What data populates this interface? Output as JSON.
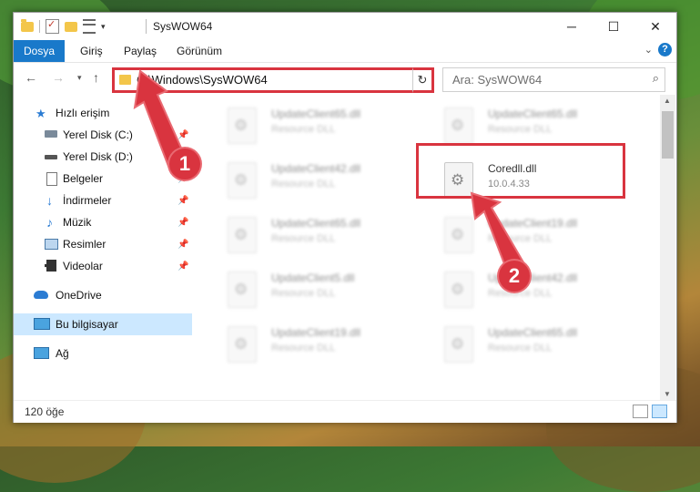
{
  "window": {
    "title": "SysWOW64"
  },
  "ribbon": {
    "tabs": [
      "Dosya",
      "Giriş",
      "Paylaş",
      "Görünüm"
    ]
  },
  "address": {
    "path": "C:\\Windows\\SysWOW64"
  },
  "search": {
    "placeholder": "Ara: SysWOW64"
  },
  "sidebar": {
    "items": [
      {
        "label": "Hızlı erişim",
        "icon": "star-icon"
      },
      {
        "label": "Yerel Disk (C:)",
        "icon": "drive-icon",
        "pinned": true
      },
      {
        "label": "Yerel Disk (D:)",
        "icon": "drive-icon"
      },
      {
        "label": "Belgeler",
        "icon": "documents-icon",
        "pinned": true
      },
      {
        "label": "İndirmeler",
        "icon": "download-icon",
        "pinned": true
      },
      {
        "label": "Müzik",
        "icon": "music-icon",
        "pinned": true
      },
      {
        "label": "Resimler",
        "icon": "pictures-icon",
        "pinned": true
      },
      {
        "label": "Videolar",
        "icon": "videos-icon",
        "pinned": true
      },
      {
        "label": "OneDrive",
        "icon": "cloud-icon"
      },
      {
        "label": "Bu bilgisayar",
        "icon": "computer-icon",
        "selected": true
      },
      {
        "label": "Ağ",
        "icon": "network-icon"
      }
    ]
  },
  "files": [
    {
      "name": "UpdateClient65.dll",
      "desc": "Resource DLL",
      "blurred": true
    },
    {
      "name": "UpdateClient65.dll",
      "desc": "Resource DLL",
      "blurred": true
    },
    {
      "name": "UpdateClient42.dll",
      "desc": "Resource DLL",
      "blurred": true
    },
    {
      "name": "Coredll.dll",
      "desc": "10.0.4.33",
      "blurred": false
    },
    {
      "name": "UpdateClient65.dll",
      "desc": "Resource DLL",
      "blurred": true
    },
    {
      "name": "UpdateClient19.dll",
      "desc": "Resource DLL",
      "blurred": true
    },
    {
      "name": "UpdateClient5.dll",
      "desc": "Resource DLL",
      "blurred": true
    },
    {
      "name": "UpdateClient42.dll",
      "desc": "Resource DLL",
      "blurred": true
    },
    {
      "name": "UpdateClient19.dll",
      "desc": "Resource DLL",
      "blurred": true
    },
    {
      "name": "UpdateClient65.dll",
      "desc": "Resource DLL",
      "blurred": true
    }
  ],
  "status": {
    "count": "120 öğe"
  },
  "annotations": {
    "step1": "1",
    "step2": "2",
    "color": "#d9343f"
  }
}
